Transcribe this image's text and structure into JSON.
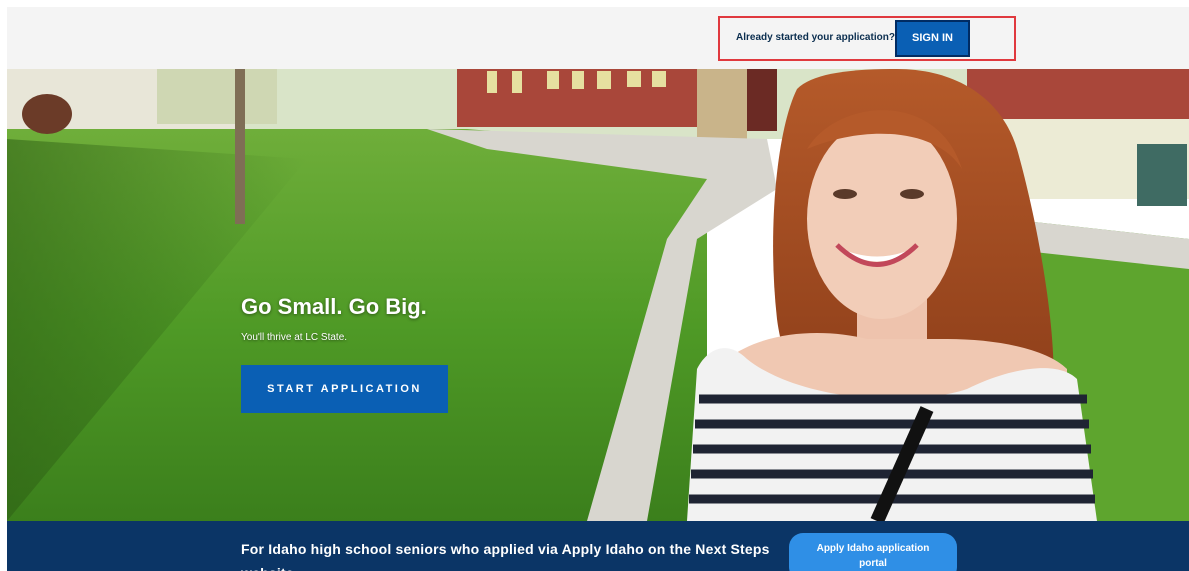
{
  "header": {
    "signin_prompt": "Already started your application?",
    "signin_label": "SIGN IN"
  },
  "hero": {
    "title": "Go Small. Go Big.",
    "subtitle": "You'll thrive at LC State.",
    "cta_label": "START APPLICATION"
  },
  "banner": {
    "text": "For Idaho high school seniors who applied via Apply Idaho on the Next Steps website.",
    "button_label": "Apply Idaho application portal"
  },
  "colors": {
    "primary_button": "#0a5fb4",
    "banner_bg": "#0b3566",
    "portal_button": "#2f8fe6",
    "highlight_border": "#e0393e"
  }
}
